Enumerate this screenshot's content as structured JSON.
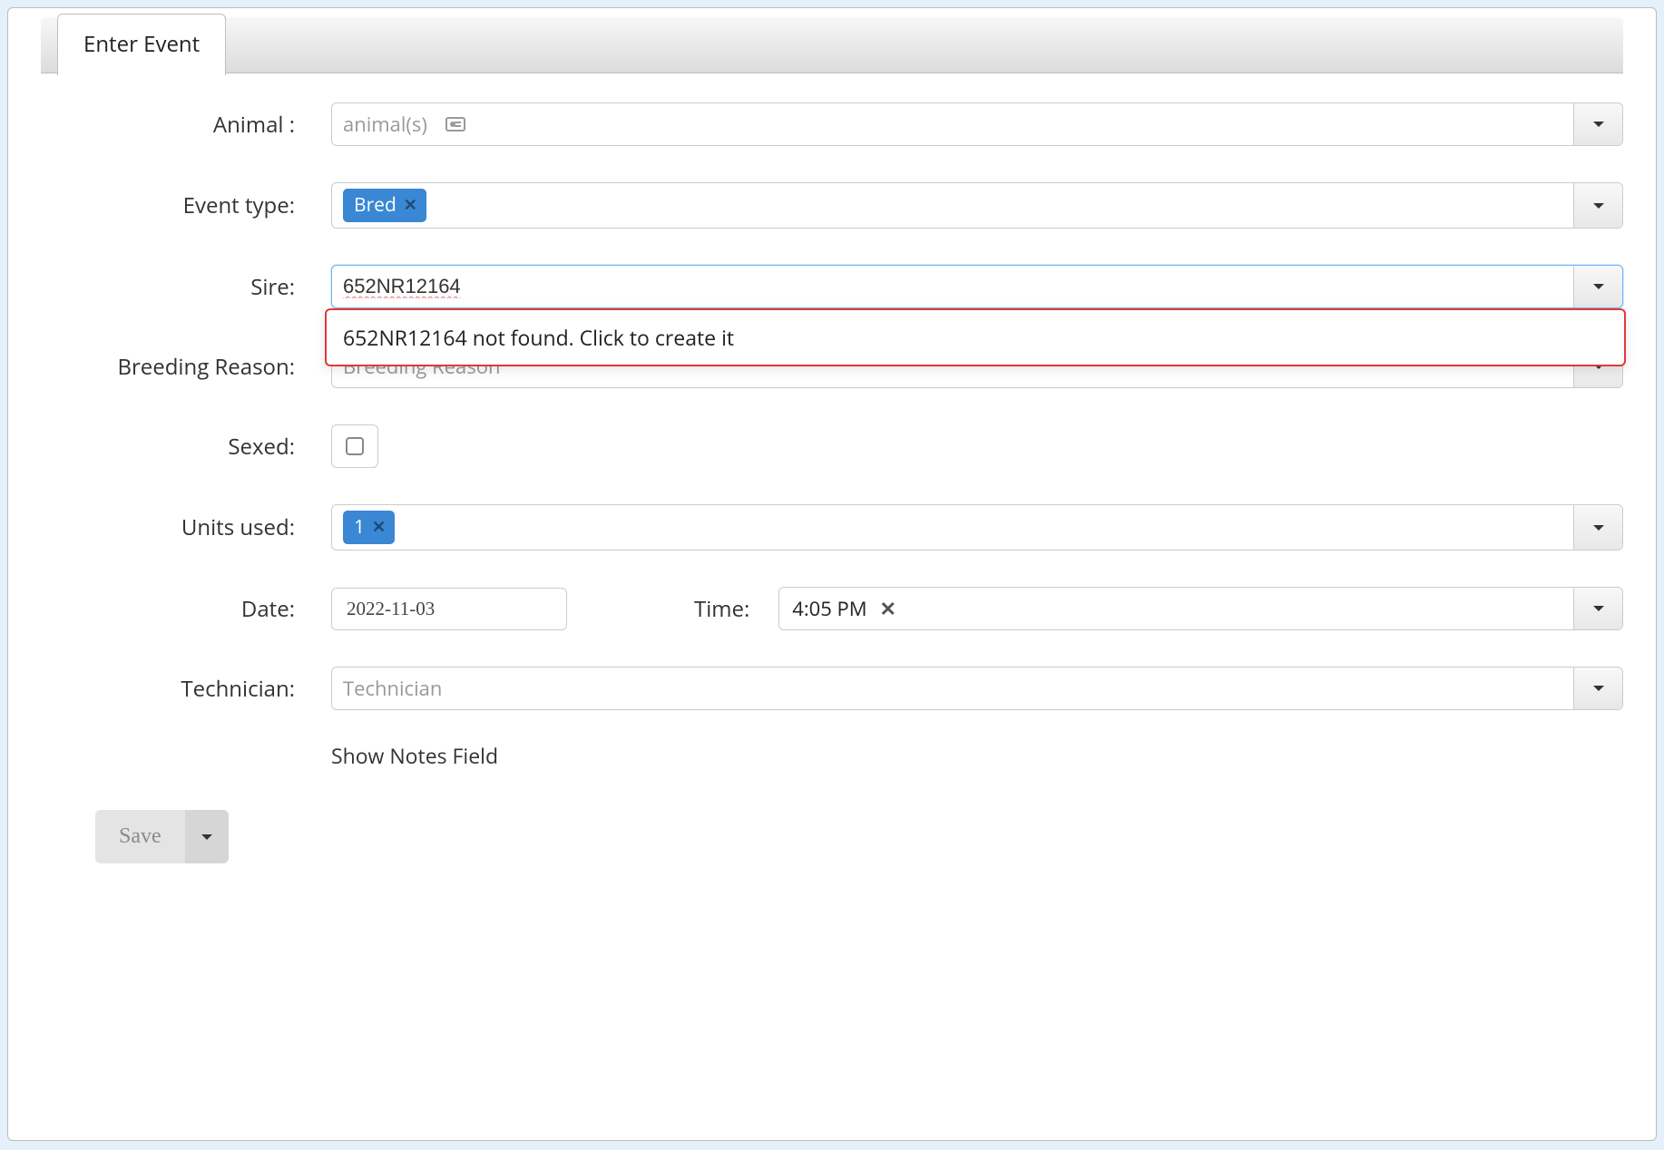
{
  "tab": {
    "label": "Enter Event"
  },
  "form": {
    "animal": {
      "label": "Animal :",
      "placeholder": "animal(s)"
    },
    "event_type": {
      "label": "Event type:",
      "tag": "Bred"
    },
    "sire": {
      "label": "Sire:",
      "value": "652NR12164",
      "not_found_message": "652NR12164 not found. Click to create it"
    },
    "breeding_reason": {
      "label": "Breeding Reason:",
      "placeholder": "Breeding Reason"
    },
    "sexed": {
      "label": "Sexed:"
    },
    "units_used": {
      "label": "Units used:",
      "tag": "1"
    },
    "date": {
      "label": "Date:",
      "value": "2022-11-03"
    },
    "time": {
      "label": "Time:",
      "value": "4:05 PM"
    },
    "technician": {
      "label": "Technician:",
      "placeholder": "Technician"
    },
    "notes_link": "Show Notes Field"
  },
  "buttons": {
    "save": "Save"
  }
}
